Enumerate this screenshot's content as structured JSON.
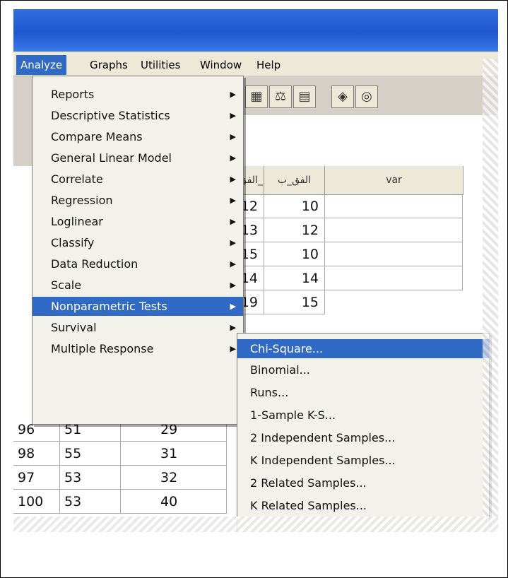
{
  "menubar": [
    {
      "label": "Analyze",
      "active": true
    },
    {
      "label": "Graphs",
      "active": false
    },
    {
      "label": "Utilities",
      "active": false
    },
    {
      "label": "Window",
      "active": false
    },
    {
      "label": "Help",
      "active": false
    }
  ],
  "toolbar_icons": [
    "table-icon",
    "scales-icon",
    "grid-chart-icon",
    "tag-icon",
    "circles-icon"
  ],
  "grid": {
    "headers": [
      "الفق_",
      "الفق_ب",
      "var"
    ],
    "right_rows": [
      [
        "12",
        "10"
      ],
      [
        "13",
        "12"
      ],
      [
        "15",
        "10"
      ],
      [
        "14",
        "14"
      ],
      [
        "19",
        "15"
      ]
    ],
    "bottom_rows": [
      [
        "96",
        "51",
        "29"
      ],
      [
        "98",
        "55",
        "31"
      ],
      [
        "97",
        "53",
        "32"
      ],
      [
        "100",
        "53",
        "40"
      ]
    ]
  },
  "analyze_menu": [
    {
      "label": "Reports",
      "submenu": true
    },
    {
      "label": "Descriptive Statistics",
      "submenu": true
    },
    {
      "label": "Compare Means",
      "submenu": true
    },
    {
      "label": "General Linear Model",
      "submenu": true
    },
    {
      "label": "Correlate",
      "submenu": true
    },
    {
      "label": "Regression",
      "submenu": true
    },
    {
      "label": "Loglinear",
      "submenu": true
    },
    {
      "label": "Classify",
      "submenu": true
    },
    {
      "label": "Data Reduction",
      "submenu": true
    },
    {
      "label": "Scale",
      "submenu": true
    },
    {
      "label": "Nonparametric Tests",
      "submenu": true,
      "selected": true
    },
    {
      "label": "Survival",
      "submenu": true
    },
    {
      "label": "Multiple Response",
      "submenu": true
    }
  ],
  "nonparametric_menu": [
    {
      "label": "Chi-Square...",
      "selected": true
    },
    {
      "label": "Binomial..."
    },
    {
      "label": "Runs..."
    },
    {
      "label": "1-Sample K-S..."
    },
    {
      "label": "2 Independent Samples..."
    },
    {
      "label": "K Independent Samples..."
    },
    {
      "label": "2 Related Samples..."
    },
    {
      "label": "K Related Samples..."
    }
  ],
  "colors": {
    "selection": "#316ac5",
    "menubar": "#ece9d8",
    "title": "#1f57d0"
  }
}
